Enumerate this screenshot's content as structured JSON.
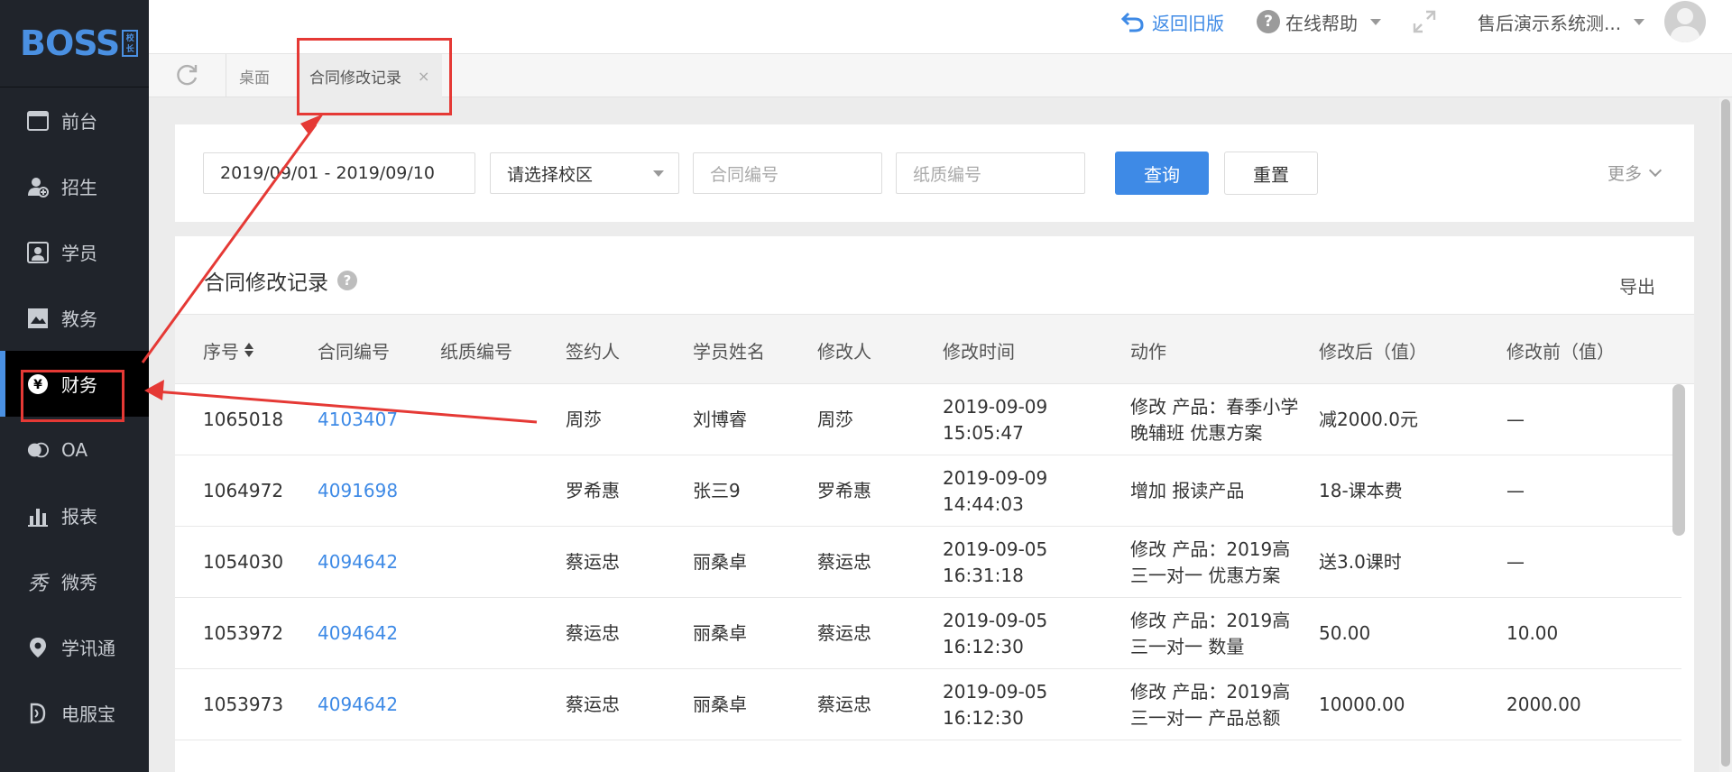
{
  "brand": {
    "logo_text": "BOSS",
    "logo_sub": "校长"
  },
  "sidebar": {
    "items": [
      {
        "label": "前台",
        "icon": "window-icon"
      },
      {
        "label": "招生",
        "icon": "user-add-icon"
      },
      {
        "label": "学员",
        "icon": "student-card-icon"
      },
      {
        "label": "教务",
        "icon": "book-icon"
      },
      {
        "label": "财务",
        "icon": "yen-icon",
        "active": true
      },
      {
        "label": "OA",
        "icon": "oa-icon"
      },
      {
        "label": "报表",
        "icon": "bar-chart-icon"
      },
      {
        "label": "微秀",
        "icon": "xiu-icon"
      },
      {
        "label": "学讯通",
        "icon": "location-icon"
      },
      {
        "label": "电服宝",
        "icon": "phone-service-icon"
      }
    ]
  },
  "header": {
    "back_label": "返回旧版",
    "help_label": "在线帮助",
    "user_label": "售后演示系统测..."
  },
  "tabs": {
    "desk_label": "桌面",
    "active_label": "合同修改记录",
    "close_glyph": "×"
  },
  "filter": {
    "date_range": "2019/09/01 - 2019/09/10",
    "campus_placeholder": "请选择校区",
    "contract_placeholder": "合同编号",
    "paper_placeholder": "纸质编号",
    "query_label": "查询",
    "reset_label": "重置",
    "more_label": "更多"
  },
  "records": {
    "title": "合同修改记录",
    "help_glyph": "?",
    "export_label": "导出",
    "columns": [
      "序号",
      "合同编号",
      "纸质编号",
      "签约人",
      "学员姓名",
      "修改人",
      "修改时间",
      "动作",
      "修改后（值）",
      "修改前（值）"
    ],
    "rows": [
      {
        "seq": "1065018",
        "contract": "4103407",
        "paper": "",
        "signer": "周莎",
        "student": "刘博睿",
        "editor": "周莎",
        "time": "2019-09-09 15:05:47",
        "action": "修改 产品：春季小学晚辅班 优惠方案",
        "after": "减2000.0元",
        "before": "—"
      },
      {
        "seq": "1064972",
        "contract": "4091698",
        "paper": "",
        "signer": "罗希惠",
        "student": "张三9",
        "editor": "罗希惠",
        "time": "2019-09-09 14:44:03",
        "action": "增加 报读产品",
        "after": "18-课本费",
        "before": "—"
      },
      {
        "seq": "1054030",
        "contract": "4094642",
        "paper": "",
        "signer": "蔡运忠",
        "student": "丽桑卓",
        "editor": "蔡运忠",
        "time": "2019-09-05 16:31:18",
        "action": "修改 产品：2019高三一对一 优惠方案",
        "after": "送3.0课时",
        "before": "—"
      },
      {
        "seq": "1053972",
        "contract": "4094642",
        "paper": "",
        "signer": "蔡运忠",
        "student": "丽桑卓",
        "editor": "蔡运忠",
        "time": "2019-09-05 16:12:30",
        "action": "修改 产品：2019高三一对一 数量",
        "after": "50.00",
        "before": "10.00"
      },
      {
        "seq": "1053973",
        "contract": "4094642",
        "paper": "",
        "signer": "蔡运忠",
        "student": "丽桑卓",
        "editor": "蔡运忠",
        "time": "2019-09-05 16:12:30",
        "action": "修改 产品：2019高三一对一 产品总额",
        "after": "10000.00",
        "before": "2000.00"
      }
    ]
  },
  "colors": {
    "accent": "#3e8ae6",
    "sidebar_bg": "#20242b",
    "annotation": "#e53935"
  }
}
